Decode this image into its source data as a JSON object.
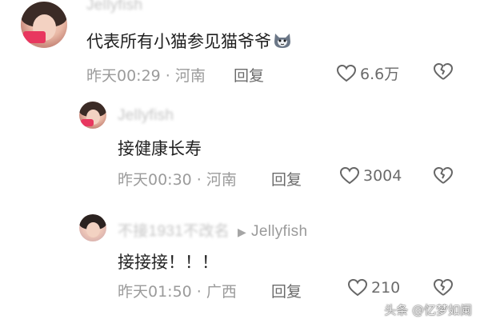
{
  "comments": [
    {
      "username": "Jellyfish",
      "text": "代表所有小猫参见猫爷爷",
      "time": "昨天00:29",
      "location": "河南",
      "reply_label": "回复",
      "likes": "6.6万"
    },
    {
      "username": "Jellyfish",
      "text": "接健康长寿",
      "time": "昨天00:30",
      "location": "河南",
      "reply_label": "回复",
      "likes": "3004"
    },
    {
      "username": "不接1931不改名",
      "reply_to": "Jellyfish",
      "text": "接接接！！！",
      "time": "昨天01:50",
      "location": "广西",
      "reply_label": "回复",
      "likes": "210"
    }
  ],
  "watermark": "头条 @忆梦如阑",
  "icons": {
    "like": "heart-outline-icon",
    "dislike": "broken-heart-icon",
    "emoji": "cat-face-emoji-icon"
  },
  "colors": {
    "meta_text": "#9b9b9b",
    "username": "#b8b8b8",
    "body_text": "#1f1f1f"
  }
}
